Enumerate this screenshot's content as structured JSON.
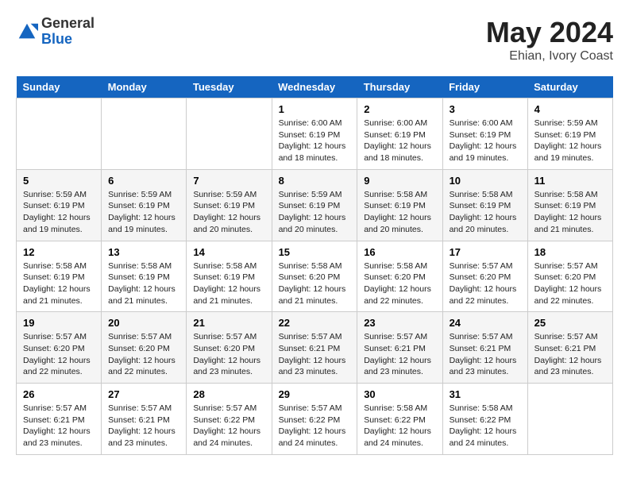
{
  "logo": {
    "general": "General",
    "blue": "Blue"
  },
  "header": {
    "month_year": "May 2024",
    "location": "Ehian, Ivory Coast"
  },
  "days_of_week": [
    "Sunday",
    "Monday",
    "Tuesday",
    "Wednesday",
    "Thursday",
    "Friday",
    "Saturday"
  ],
  "weeks": [
    [
      {
        "day": "",
        "info": ""
      },
      {
        "day": "",
        "info": ""
      },
      {
        "day": "",
        "info": ""
      },
      {
        "day": "1",
        "info": "Sunrise: 6:00 AM\nSunset: 6:19 PM\nDaylight: 12 hours\nand 18 minutes."
      },
      {
        "day": "2",
        "info": "Sunrise: 6:00 AM\nSunset: 6:19 PM\nDaylight: 12 hours\nand 18 minutes."
      },
      {
        "day": "3",
        "info": "Sunrise: 6:00 AM\nSunset: 6:19 PM\nDaylight: 12 hours\nand 19 minutes."
      },
      {
        "day": "4",
        "info": "Sunrise: 5:59 AM\nSunset: 6:19 PM\nDaylight: 12 hours\nand 19 minutes."
      }
    ],
    [
      {
        "day": "5",
        "info": "Sunrise: 5:59 AM\nSunset: 6:19 PM\nDaylight: 12 hours\nand 19 minutes."
      },
      {
        "day": "6",
        "info": "Sunrise: 5:59 AM\nSunset: 6:19 PM\nDaylight: 12 hours\nand 19 minutes."
      },
      {
        "day": "7",
        "info": "Sunrise: 5:59 AM\nSunset: 6:19 PM\nDaylight: 12 hours\nand 20 minutes."
      },
      {
        "day": "8",
        "info": "Sunrise: 5:59 AM\nSunset: 6:19 PM\nDaylight: 12 hours\nand 20 minutes."
      },
      {
        "day": "9",
        "info": "Sunrise: 5:58 AM\nSunset: 6:19 PM\nDaylight: 12 hours\nand 20 minutes."
      },
      {
        "day": "10",
        "info": "Sunrise: 5:58 AM\nSunset: 6:19 PM\nDaylight: 12 hours\nand 20 minutes."
      },
      {
        "day": "11",
        "info": "Sunrise: 5:58 AM\nSunset: 6:19 PM\nDaylight: 12 hours\nand 21 minutes."
      }
    ],
    [
      {
        "day": "12",
        "info": "Sunrise: 5:58 AM\nSunset: 6:19 PM\nDaylight: 12 hours\nand 21 minutes."
      },
      {
        "day": "13",
        "info": "Sunrise: 5:58 AM\nSunset: 6:19 PM\nDaylight: 12 hours\nand 21 minutes."
      },
      {
        "day": "14",
        "info": "Sunrise: 5:58 AM\nSunset: 6:19 PM\nDaylight: 12 hours\nand 21 minutes."
      },
      {
        "day": "15",
        "info": "Sunrise: 5:58 AM\nSunset: 6:20 PM\nDaylight: 12 hours\nand 21 minutes."
      },
      {
        "day": "16",
        "info": "Sunrise: 5:58 AM\nSunset: 6:20 PM\nDaylight: 12 hours\nand 22 minutes."
      },
      {
        "day": "17",
        "info": "Sunrise: 5:57 AM\nSunset: 6:20 PM\nDaylight: 12 hours\nand 22 minutes."
      },
      {
        "day": "18",
        "info": "Sunrise: 5:57 AM\nSunset: 6:20 PM\nDaylight: 12 hours\nand 22 minutes."
      }
    ],
    [
      {
        "day": "19",
        "info": "Sunrise: 5:57 AM\nSunset: 6:20 PM\nDaylight: 12 hours\nand 22 minutes."
      },
      {
        "day": "20",
        "info": "Sunrise: 5:57 AM\nSunset: 6:20 PM\nDaylight: 12 hours\nand 22 minutes."
      },
      {
        "day": "21",
        "info": "Sunrise: 5:57 AM\nSunset: 6:20 PM\nDaylight: 12 hours\nand 23 minutes."
      },
      {
        "day": "22",
        "info": "Sunrise: 5:57 AM\nSunset: 6:21 PM\nDaylight: 12 hours\nand 23 minutes."
      },
      {
        "day": "23",
        "info": "Sunrise: 5:57 AM\nSunset: 6:21 PM\nDaylight: 12 hours\nand 23 minutes."
      },
      {
        "day": "24",
        "info": "Sunrise: 5:57 AM\nSunset: 6:21 PM\nDaylight: 12 hours\nand 23 minutes."
      },
      {
        "day": "25",
        "info": "Sunrise: 5:57 AM\nSunset: 6:21 PM\nDaylight: 12 hours\nand 23 minutes."
      }
    ],
    [
      {
        "day": "26",
        "info": "Sunrise: 5:57 AM\nSunset: 6:21 PM\nDaylight: 12 hours\nand 23 minutes."
      },
      {
        "day": "27",
        "info": "Sunrise: 5:57 AM\nSunset: 6:21 PM\nDaylight: 12 hours\nand 23 minutes."
      },
      {
        "day": "28",
        "info": "Sunrise: 5:57 AM\nSunset: 6:22 PM\nDaylight: 12 hours\nand 24 minutes."
      },
      {
        "day": "29",
        "info": "Sunrise: 5:57 AM\nSunset: 6:22 PM\nDaylight: 12 hours\nand 24 minutes."
      },
      {
        "day": "30",
        "info": "Sunrise: 5:58 AM\nSunset: 6:22 PM\nDaylight: 12 hours\nand 24 minutes."
      },
      {
        "day": "31",
        "info": "Sunrise: 5:58 AM\nSunset: 6:22 PM\nDaylight: 12 hours\nand 24 minutes."
      },
      {
        "day": "",
        "info": ""
      }
    ]
  ]
}
